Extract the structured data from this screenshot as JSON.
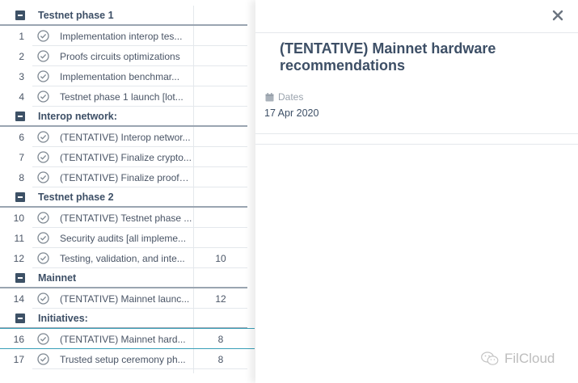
{
  "list": {
    "groups": [
      {
        "label": "Testnet phase 1"
      },
      {
        "label": "Interop network:"
      },
      {
        "label": "Testnet phase 2"
      },
      {
        "label": "Mainnet"
      },
      {
        "label": "Initiatives:"
      }
    ],
    "tasks": [
      {
        "num": "1",
        "name": "Implementation interop tes...",
        "value": ""
      },
      {
        "num": "2",
        "name": "Proofs circuits optimizations",
        "value": ""
      },
      {
        "num": "3",
        "name": "Implementation benchmar...",
        "value": ""
      },
      {
        "num": "4",
        "name": "Testnet phase 1 launch [lot...",
        "value": ""
      },
      {
        "num": "6",
        "name": "(TENTATIVE) Interop networ...",
        "value": ""
      },
      {
        "num": "7",
        "name": "(TENTATIVE) Finalize crypto...",
        "value": ""
      },
      {
        "num": "8",
        "name": "(TENTATIVE) Finalize proofs ...",
        "value": ""
      },
      {
        "num": "10",
        "name": "(TENTATIVE) Testnet phase ...",
        "value": ""
      },
      {
        "num": "11",
        "name": "Security audits [all impleme...",
        "value": ""
      },
      {
        "num": "12",
        "name": "Testing, validation, and inte...",
        "value": "10"
      },
      {
        "num": "14",
        "name": "(TENTATIVE) Mainnet launc...",
        "value": "12"
      },
      {
        "num": "16",
        "name": "(TENTATIVE) Mainnet hard...",
        "value": "8"
      },
      {
        "num": "17",
        "name": "Trusted setup ceremony ph...",
        "value": "8"
      }
    ]
  },
  "detail": {
    "title": "(TENTATIVE) Mainnet hardware recommendations",
    "dates_label": "Dates",
    "dates_value": "17 Apr 2020",
    "close_icon": "close-icon"
  },
  "watermark": {
    "text": "FilCloud"
  },
  "colors": {
    "text": "#3d4f66",
    "group_toggle": "#3d5166",
    "selection": "#3aa0b8",
    "muted": "#9aa3ad"
  }
}
